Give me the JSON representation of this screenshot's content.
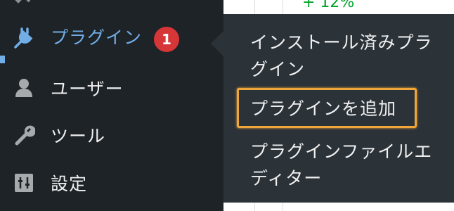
{
  "sidebar": {
    "items": [
      {
        "label": "プラグイン",
        "icon": "plugin-icon",
        "active": true,
        "badge": "1"
      },
      {
        "label": "ユーザー",
        "icon": "user-icon"
      },
      {
        "label": "ツール",
        "icon": "wrench-icon"
      },
      {
        "label": "設定",
        "icon": "settings-icon"
      }
    ]
  },
  "submenu": {
    "items": [
      {
        "label": "インストール済みプラグイン"
      },
      {
        "label": "プラグインを追加",
        "highlighted": true
      },
      {
        "label": "プラグインファイルエディター"
      }
    ]
  },
  "content": {
    "peek_text": "+ 12%"
  },
  "colors": {
    "sidebar_bg": "#1d2327",
    "flyout_bg": "#2c3338",
    "accent": "#72aee6",
    "badge": "#d63638",
    "highlight": "#f0a63b"
  }
}
